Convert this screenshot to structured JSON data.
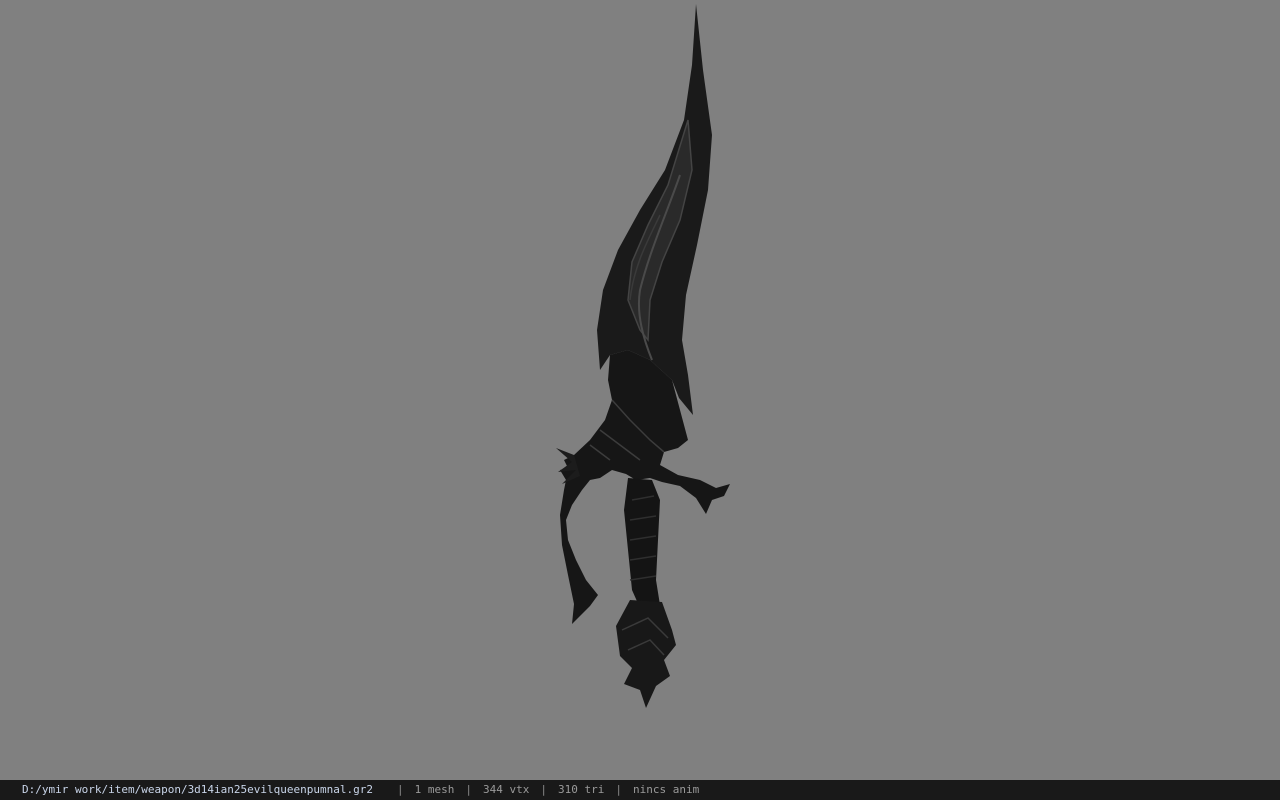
{
  "viewport": {
    "background_color": "#808080",
    "model_color": "#1a1a1a",
    "model_highlight_color": "#3c3c3c"
  },
  "status_bar": {
    "file_path": "D:/ymir work/item/weapon/3d14ian25evilqueenpumnal.gr2",
    "separator": "|",
    "mesh_count": "1 mesh",
    "vertex_count": "344 vtx",
    "triangle_count": "310 tri",
    "animation": "nincs anim"
  }
}
